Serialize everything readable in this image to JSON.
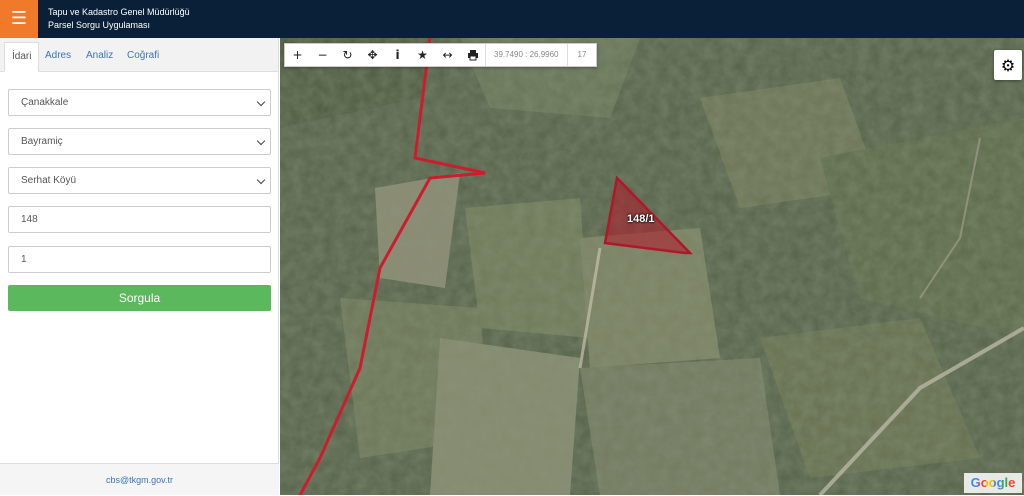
{
  "header": {
    "menu_icon": "hamburger-icon",
    "title_line1": "Tapu ve Kadastro Genel Müdürlüğü",
    "title_line2": "Parsel Sorgu Uygulaması",
    "background_color": "#0a2038",
    "accent_color": "#f07a2a"
  },
  "sidebar": {
    "tabs": [
      {
        "label": "İdari",
        "active": true
      },
      {
        "label": "Adres",
        "active": false
      },
      {
        "label": "Analiz",
        "active": false
      },
      {
        "label": "Coğrafi",
        "active": false
      }
    ],
    "province": "Çanakkale",
    "district": "Bayramiç",
    "neighborhood": "Serhat Köyü",
    "block_number": "148",
    "parcel_number": "1",
    "query_button": "Sorgula",
    "query_button_color": "#5cb85c",
    "footer_email": "cbs@tkgm.gov.tr"
  },
  "map": {
    "toolbar": {
      "tools": [
        "zoom-in-icon",
        "zoom-out-icon",
        "refresh-icon",
        "locate-icon",
        "info-icon",
        "star-icon",
        "measure-icon",
        "print-icon"
      ],
      "coordinates": "39.7490 : 26.9960",
      "zoom": "17"
    },
    "settings_icon": "gear-icon",
    "parcel_label": "148/1",
    "parcel_color": "#b0172a",
    "attribution": "Google"
  }
}
